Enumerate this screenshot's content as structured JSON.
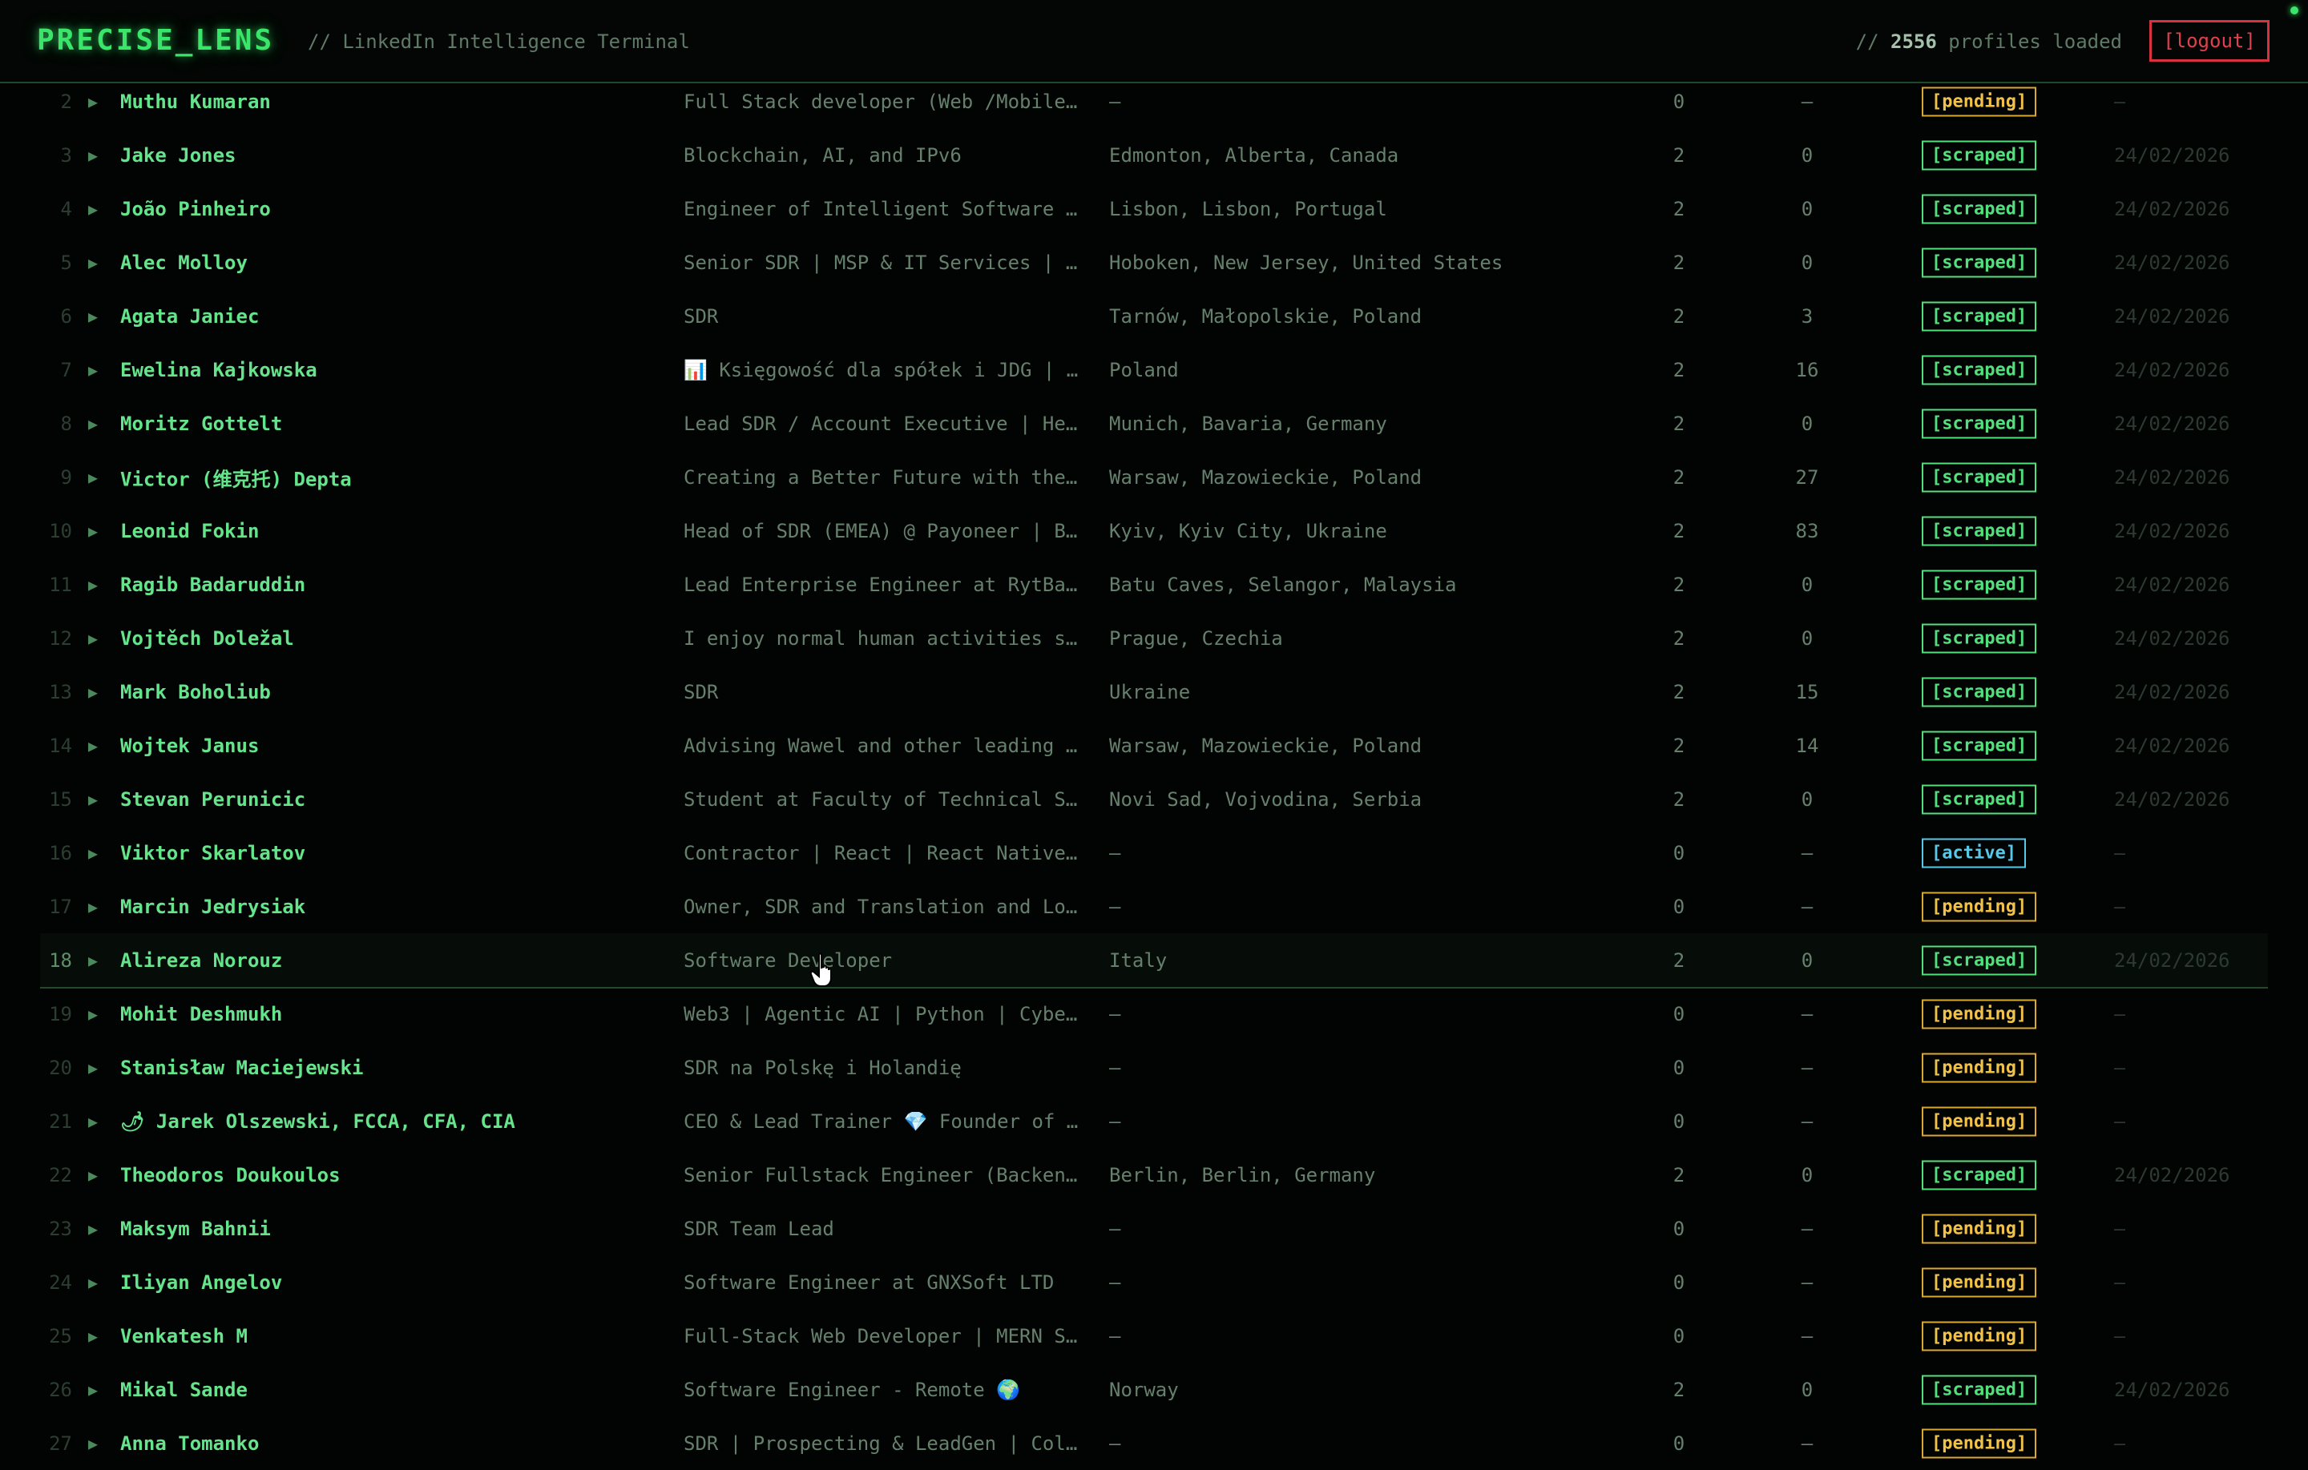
{
  "header": {
    "brand": "PRECISE_LENS",
    "subtitle": "// LinkedIn Intelligence Terminal",
    "profiles_prefix": "//",
    "profiles_count": "2556",
    "profiles_suffix": "profiles loaded",
    "logout_label": "[logout]"
  },
  "colors": {
    "background": "#020403",
    "brand_green": "#39e66a",
    "scraped": "#52e07c",
    "pending": "#f0c24a",
    "active": "#56c8ea",
    "logout": "#e0404d"
  },
  "rows": [
    {
      "num": "2",
      "name": "Muthu Kumaran",
      "headline": "Full Stack developer (Web /Mobile…",
      "location": "—",
      "a": "0",
      "b": "—",
      "status": "[pending]",
      "status_type": "pending",
      "date": "—"
    },
    {
      "num": "3",
      "name": "Jake Jones",
      "headline": "Blockchain, AI, and IPv6",
      "location": "Edmonton, Alberta, Canada",
      "a": "2",
      "b": "0",
      "status": "[scraped]",
      "status_type": "scraped",
      "date": "24/02/2026"
    },
    {
      "num": "4",
      "name": "João Pinheiro",
      "headline": "Engineer of Intelligent Software …",
      "location": "Lisbon, Lisbon, Portugal",
      "a": "2",
      "b": "0",
      "status": "[scraped]",
      "status_type": "scraped",
      "date": "24/02/2026"
    },
    {
      "num": "5",
      "name": "Alec Molloy",
      "headline": "Senior SDR | MSP & IT Services | …",
      "location": "Hoboken, New Jersey, United States",
      "a": "2",
      "b": "0",
      "status": "[scraped]",
      "status_type": "scraped",
      "date": "24/02/2026"
    },
    {
      "num": "6",
      "name": "Agata Janiec",
      "headline": "SDR",
      "location": "Tarnów, Małopolskie, Poland",
      "a": "2",
      "b": "3",
      "status": "[scraped]",
      "status_type": "scraped",
      "date": "24/02/2026"
    },
    {
      "num": "7",
      "name": "Ewelina Kajkowska",
      "headline": "📊 Księgowość dla spółek i JDG | …",
      "location": "Poland",
      "a": "2",
      "b": "16",
      "status": "[scraped]",
      "status_type": "scraped",
      "date": "24/02/2026"
    },
    {
      "num": "8",
      "name": "Moritz Gottelt",
      "headline": "Lead SDR / Account Executive | He…",
      "location": "Munich, Bavaria, Germany",
      "a": "2",
      "b": "0",
      "status": "[scraped]",
      "status_type": "scraped",
      "date": "24/02/2026"
    },
    {
      "num": "9",
      "name": "Victor (维克托) Depta",
      "headline": "Creating a Better Future with the…",
      "location": "Warsaw, Mazowieckie, Poland",
      "a": "2",
      "b": "27",
      "status": "[scraped]",
      "status_type": "scraped",
      "date": "24/02/2026"
    },
    {
      "num": "10",
      "name": "Leonid Fokin",
      "headline": "Head of SDR (EMEA) @ Payoneer | B…",
      "location": "Kyiv, Kyiv City, Ukraine",
      "a": "2",
      "b": "83",
      "status": "[scraped]",
      "status_type": "scraped",
      "date": "24/02/2026"
    },
    {
      "num": "11",
      "name": "Ragib Badaruddin",
      "headline": "Lead Enterprise Engineer at RytBa…",
      "location": "Batu Caves, Selangor, Malaysia",
      "a": "2",
      "b": "0",
      "status": "[scraped]",
      "status_type": "scraped",
      "date": "24/02/2026"
    },
    {
      "num": "12",
      "name": "Vojtěch Doležal",
      "headline": "I enjoy normal human activities s…",
      "location": "Prague, Czechia",
      "a": "2",
      "b": "0",
      "status": "[scraped]",
      "status_type": "scraped",
      "date": "24/02/2026"
    },
    {
      "num": "13",
      "name": "Mark Boholiub",
      "headline": "SDR",
      "location": "Ukraine",
      "a": "2",
      "b": "15",
      "status": "[scraped]",
      "status_type": "scraped",
      "date": "24/02/2026"
    },
    {
      "num": "14",
      "name": "Wojtek Janus",
      "headline": "Advising Wawel and other leading …",
      "location": "Warsaw, Mazowieckie, Poland",
      "a": "2",
      "b": "14",
      "status": "[scraped]",
      "status_type": "scraped",
      "date": "24/02/2026"
    },
    {
      "num": "15",
      "name": "Stevan Perunicic",
      "headline": "Student at Faculty of Technical S…",
      "location": "Novi Sad, Vojvodina, Serbia",
      "a": "2",
      "b": "0",
      "status": "[scraped]",
      "status_type": "scraped",
      "date": "24/02/2026"
    },
    {
      "num": "16",
      "name": "Viktor Skarlatov",
      "headline": "Contractor | React | React Native…",
      "location": "—",
      "a": "0",
      "b": "—",
      "status": "[active]",
      "status_type": "active",
      "date": "—"
    },
    {
      "num": "17",
      "name": "Marcin Jedrysiak",
      "headline": "Owner, SDR and Translation and Lo…",
      "location": "—",
      "a": "0",
      "b": "—",
      "status": "[pending]",
      "status_type": "pending",
      "date": "—"
    },
    {
      "num": "18",
      "name": "Alireza Norouz",
      "headline": "Software Developer",
      "location": "Italy",
      "a": "2",
      "b": "0",
      "status": "[scraped]",
      "status_type": "scraped",
      "date": "24/02/2026"
    },
    {
      "num": "19",
      "name": "Mohit Deshmukh",
      "headline": "Web3 | Agentic AI | Python | Cybe…",
      "location": "—",
      "a": "0",
      "b": "—",
      "status": "[pending]",
      "status_type": "pending",
      "date": "—"
    },
    {
      "num": "20",
      "name": "Stanisław Maciejewski",
      "headline": "SDR na Polskę i Holandię",
      "location": "—",
      "a": "0",
      "b": "—",
      "status": "[pending]",
      "status_type": "pending",
      "date": "—"
    },
    {
      "num": "21",
      "name": "🌶 Jarek Olszewski, FCCA, CFA, CIA",
      "headline": "CEO & Lead Trainer 💎 Founder of …",
      "location": "—",
      "a": "0",
      "b": "—",
      "status": "[pending]",
      "status_type": "pending",
      "date": "—"
    },
    {
      "num": "22",
      "name": "Theodoros Doukoulos",
      "headline": "Senior Fullstack Engineer (Backen…",
      "location": "Berlin, Berlin, Germany",
      "a": "2",
      "b": "0",
      "status": "[scraped]",
      "status_type": "scraped",
      "date": "24/02/2026"
    },
    {
      "num": "23",
      "name": "Maksym Bahnii",
      "headline": "SDR Team Lead",
      "location": "—",
      "a": "0",
      "b": "—",
      "status": "[pending]",
      "status_type": "pending",
      "date": "—"
    },
    {
      "num": "24",
      "name": "Iliyan Angelov",
      "headline": "Software Engineer at GNXSoft LTD",
      "location": "—",
      "a": "0",
      "b": "—",
      "status": "[pending]",
      "status_type": "pending",
      "date": "—"
    },
    {
      "num": "25",
      "name": "Venkatesh M",
      "headline": "Full-Stack Web Developer | MERN S…",
      "location": "—",
      "a": "0",
      "b": "—",
      "status": "[pending]",
      "status_type": "pending",
      "date": "—"
    },
    {
      "num": "26",
      "name": "Mikal Sande",
      "headline": "Software Engineer - Remote 🌍",
      "location": "Norway",
      "a": "2",
      "b": "0",
      "status": "[scraped]",
      "status_type": "scraped",
      "date": "24/02/2026"
    },
    {
      "num": "27",
      "name": "Anna Tomanko",
      "headline": "SDR | Prospecting & LeadGen | Col…",
      "location": "—",
      "a": "0",
      "b": "—",
      "status": "[pending]",
      "status_type": "pending",
      "date": "—"
    }
  ],
  "hover_row_index": 16,
  "icons": {
    "expand": "expand-arrow-icon",
    "cursor": "hand-pointer-icon"
  }
}
